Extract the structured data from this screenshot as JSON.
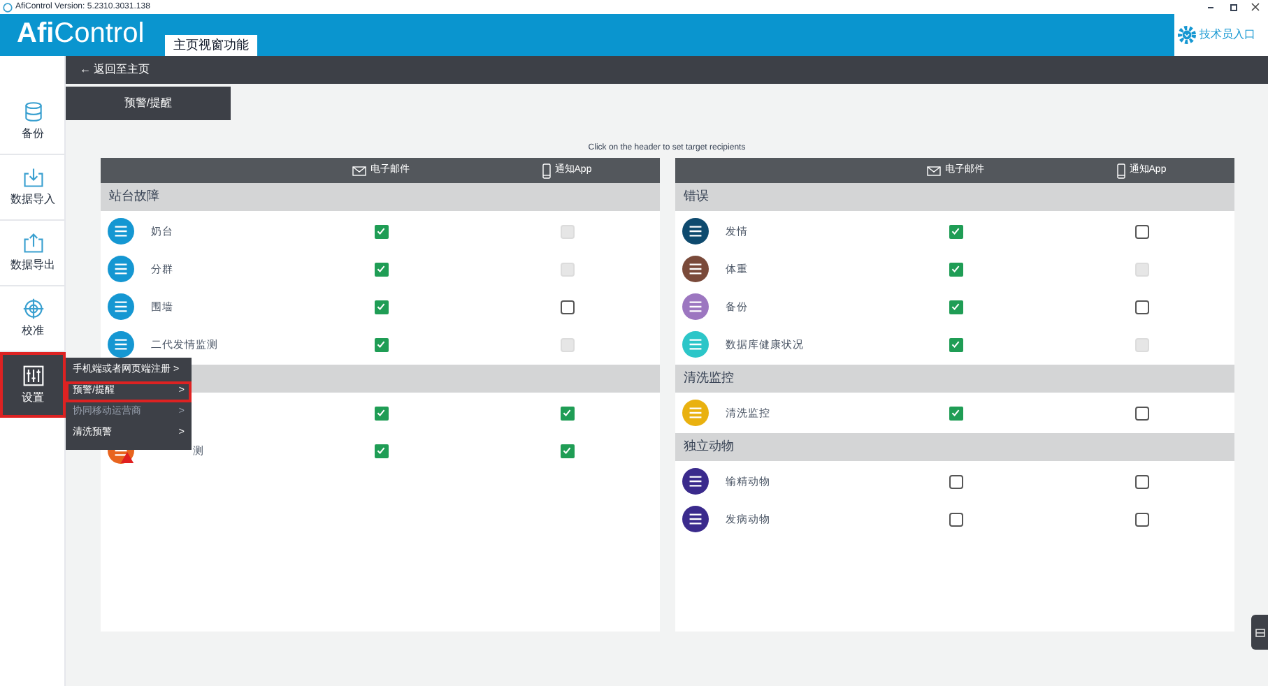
{
  "window": {
    "title": "AfiControl Version: 5.2310.3031.138"
  },
  "header": {
    "logo_bold": "Afi",
    "logo_light": "Control",
    "label": "主页视窗功能",
    "technician_link": "技术员入口"
  },
  "sidebar": {
    "items": [
      {
        "label": "备份",
        "selected": false
      },
      {
        "label": "数据导入",
        "selected": false
      },
      {
        "label": "数据导出",
        "selected": false
      },
      {
        "label": "校准",
        "selected": false
      },
      {
        "label": "设置",
        "selected": true
      }
    ]
  },
  "settings_menu": [
    {
      "label": "手机端或者网页端注册 >",
      "selected": false,
      "disabled": false
    },
    {
      "label": "预警/提醒",
      "arrow": ">",
      "selected": true,
      "disabled": false
    },
    {
      "label": "协同移动运营商",
      "arrow": ">",
      "selected": false,
      "disabled": true
    },
    {
      "label": "清洗预警",
      "arrow": ">",
      "selected": false,
      "disabled": false
    }
  ],
  "back_link": "← 返回至主页",
  "tab": "预警/提醒",
  "hint": "Click on the header to set target recipients",
  "panels": [
    {
      "columns": [
        "电子邮件",
        "通知App"
      ],
      "sections": [
        {
          "title": "站台故障",
          "rows": [
            {
              "label": "奶台",
              "color": "#1597d2",
              "email": {
                "checked": true,
                "disabled": false
              },
              "app": {
                "checked": false,
                "disabled": true
              }
            },
            {
              "label": "分群",
              "color": "#1597d2",
              "email": {
                "checked": true,
                "disabled": false
              },
              "app": {
                "checked": false,
                "disabled": true
              }
            },
            {
              "label": "围墙",
              "color": "#1597d2",
              "email": {
                "checked": true,
                "disabled": false
              },
              "app": {
                "checked": false,
                "disabled": false
              }
            },
            {
              "label": "二代发情监测",
              "color": "#1597d2",
              "email": {
                "checked": true,
                "disabled": false
              },
              "app": {
                "checked": false,
                "disabled": true
              }
            }
          ]
        },
        {
          "rows": [
            {
              "email": {
                "checked": true,
                "disabled": false
              },
              "app": {
                "checked": true,
                "disabled": false
              }
            },
            {
              "label": "测",
              "cut": true,
              "color": "#e8641e",
              "warning": true,
              "email": {
                "checked": true,
                "disabled": false
              },
              "app": {
                "checked": true,
                "disabled": false
              }
            }
          ]
        }
      ]
    },
    {
      "columns": [
        "电子邮件",
        "通知App"
      ],
      "sections": [
        {
          "title": "错误",
          "rows": [
            {
              "label": "发情",
              "color": "#0e4a6e",
              "email": {
                "checked": true,
                "disabled": false
              },
              "app": {
                "checked": false,
                "disabled": false
              }
            },
            {
              "label": "体重",
              "color": "#7a4a3a",
              "email": {
                "checked": true,
                "disabled": false
              },
              "app": {
                "checked": false,
                "disabled": true
              }
            },
            {
              "label": "备份",
              "color": "#9c76c0",
              "email": {
                "checked": true,
                "disabled": false
              },
              "app": {
                "checked": false,
                "disabled": false
              }
            },
            {
              "label": "数据库健康状况",
              "color": "#2cc6c8",
              "email": {
                "checked": true,
                "disabled": false
              },
              "app": {
                "checked": false,
                "disabled": true
              }
            }
          ]
        },
        {
          "title": "清洗监控",
          "rows": [
            {
              "label": "清洗监控",
              "color": "#e9b10f",
              "email": {
                "checked": true,
                "disabled": false
              },
              "app": {
                "checked": false,
                "disabled": false
              }
            }
          ]
        },
        {
          "title": "独立动物",
          "rows": [
            {
              "label": "输精动物",
              "color": "#3a2a8c",
              "email": {
                "checked": false,
                "disabled": false
              },
              "app": {
                "checked": false,
                "disabled": false
              }
            },
            {
              "label": "发病动物",
              "color": "#3a2a8c",
              "email": {
                "checked": false,
                "disabled": false
              },
              "app": {
                "checked": false,
                "disabled": false
              }
            }
          ]
        }
      ]
    }
  ]
}
